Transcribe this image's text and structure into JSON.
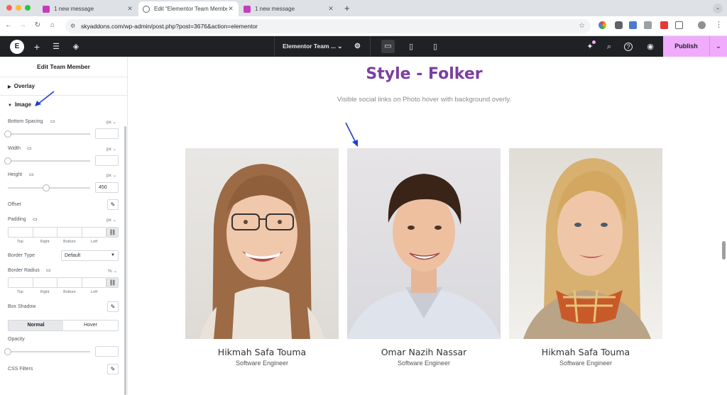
{
  "browser": {
    "tabs": [
      {
        "label": "1 new message"
      },
      {
        "label": "Edit “Elementor Team Membe"
      },
      {
        "label": "1 new message"
      }
    ],
    "url": "skyaddons.com/wp-admin/post.php?post=3676&action=elementor"
  },
  "editor": {
    "document_title": "Elementor Team ...",
    "publish_label": "Publish"
  },
  "panel": {
    "title": "Edit Team Member",
    "sections": {
      "overlay": "Overlay",
      "image": "Image"
    },
    "controls": {
      "bottom_spacing": {
        "label": "Bottom Spacing",
        "unit": "px",
        "value": ""
      },
      "width": {
        "label": "Width",
        "unit": "px",
        "value": ""
      },
      "height": {
        "label": "Height",
        "unit": "px",
        "value": "450"
      },
      "offset": {
        "label": "Offset"
      },
      "padding": {
        "label": "Padding",
        "unit": "px"
      },
      "border_type": {
        "label": "Border Type",
        "value": "Default"
      },
      "border_radius": {
        "label": "Border Radius",
        "unit": "%"
      },
      "box_shadow": {
        "label": "Box Shadow"
      },
      "opacity": {
        "label": "Opacity",
        "value": ""
      },
      "css_filters": {
        "label": "CSS Filters"
      }
    },
    "quad_labels": [
      "Top",
      "Right",
      "Bottom",
      "Left"
    ],
    "tabs": {
      "normal": "Normal",
      "hover": "Hover"
    }
  },
  "canvas": {
    "heading": "Style - Folker",
    "subheading": "Visible social links on Photo hover with background overly.",
    "members": [
      {
        "name": "Hikmah Safa Touma",
        "role": "Software Engineer"
      },
      {
        "name": "Omar Nazih Nassar",
        "role": "Software Engineer"
      },
      {
        "name": "Hikmah Safa Touma",
        "role": "Software Engineer"
      }
    ]
  },
  "colors": {
    "heading": "#7b3fa0",
    "publish": "#f0abfc",
    "topbar": "#1f2124",
    "annotation_arrow": "#1d3fd6"
  }
}
